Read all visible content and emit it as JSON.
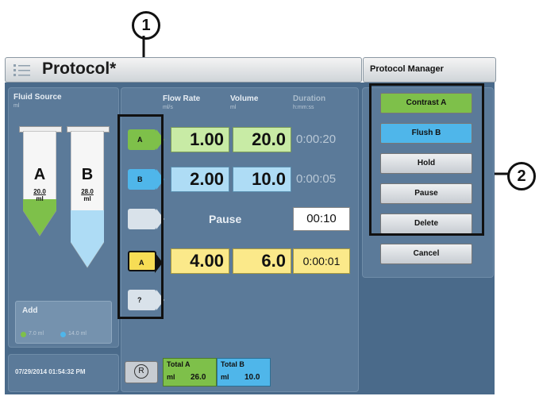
{
  "callouts": {
    "one": "1",
    "two": "2"
  },
  "header": {
    "title": "Protocol*",
    "protocol_manager": "Protocol Manager"
  },
  "fluid_source": {
    "label": "Fluid Source",
    "unit": "ml",
    "tube_a": {
      "letter": "A",
      "volume": "20.0",
      "unit": "ml"
    },
    "tube_b": {
      "letter": "B",
      "volume": "28.0",
      "unit": "ml"
    }
  },
  "add": {
    "label": "Add",
    "a_amount": "7.0 ml",
    "b_amount": "14.0 ml"
  },
  "datetime": "07/29/2014 01:54:32 PM",
  "columns": {
    "flow_rate": {
      "label": "Flow Rate",
      "unit": "ml/s"
    },
    "volume": {
      "label": "Volume",
      "unit": "ml"
    },
    "duration": {
      "label": "Duration",
      "unit": "h:mm:ss"
    }
  },
  "phases": [
    {
      "tag": "A",
      "flow": "1.00",
      "volume": "20.0",
      "duration": "0:00:20"
    },
    {
      "tag": "B",
      "flow": "2.00",
      "volume": "10.0",
      "duration": "0:00:05"
    },
    {
      "tag": "",
      "pause_label": "Pause",
      "pause_time": "00:10"
    },
    {
      "tag": "A",
      "flow": "4.00",
      "volume": "6.0",
      "duration": "0:00:01"
    },
    {
      "tag": "?"
    }
  ],
  "totals": {
    "reset": "R",
    "a_label": "Total A",
    "a_unit": "ml",
    "a_value": "26.0",
    "b_label": "Total B",
    "b_unit": "ml",
    "b_value": "10.0"
  },
  "menu": {
    "contrast_a": "Contrast A",
    "flush_b": "Flush B",
    "hold": "Hold",
    "pause": "Pause",
    "delete": "Delete",
    "cancel": "Cancel"
  },
  "colors": {
    "contrast_green": "#7ec04a",
    "flush_blue": "#4fb6ea",
    "yellow": "#f7dd55",
    "screen": "#4a6a8a"
  }
}
